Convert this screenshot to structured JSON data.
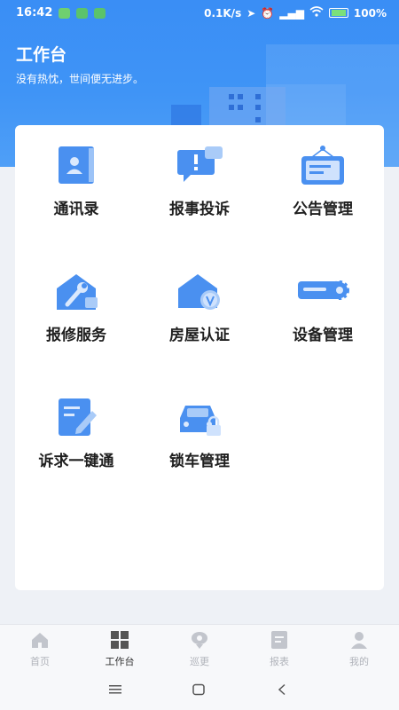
{
  "status_bar": {
    "time": "16:42",
    "network_speed": "0.1K/s",
    "battery": "100%",
    "icons": [
      "notification-app-icon",
      "location-icon",
      "alarm-icon",
      "signal-icon",
      "wifi-icon",
      "battery-icon"
    ]
  },
  "header": {
    "title": "工作台",
    "subtitle": "没有热忱，世间便无进步。"
  },
  "grid": [
    {
      "label": "通讯录",
      "icon": "contacts-book-icon"
    },
    {
      "label": "报事投诉",
      "icon": "complaint-message-icon"
    },
    {
      "label": "公告管理",
      "icon": "notice-board-icon"
    },
    {
      "label": "报修服务",
      "icon": "repair-wrench-icon"
    },
    {
      "label": "房屋认证",
      "icon": "house-verify-icon"
    },
    {
      "label": "设备管理",
      "icon": "device-settings-icon"
    },
    {
      "label": "诉求一键通",
      "icon": "edit-document-icon"
    },
    {
      "label": "锁车管理",
      "icon": "car-lock-icon"
    }
  ],
  "bottom_nav": [
    {
      "label": "首页",
      "icon": "home-icon",
      "active": false
    },
    {
      "label": "工作台",
      "icon": "grid-icon",
      "active": true
    },
    {
      "label": "巡更",
      "icon": "patrol-location-icon",
      "active": false
    },
    {
      "label": "报表",
      "icon": "report-icon",
      "active": false
    },
    {
      "label": "我的",
      "icon": "profile-icon",
      "active": false
    }
  ],
  "colors": {
    "primary": "#3a8ef5",
    "icon_blue": "#4a90f0",
    "nav_active": "#333333",
    "nav_inactive": "#b0b3ba"
  }
}
